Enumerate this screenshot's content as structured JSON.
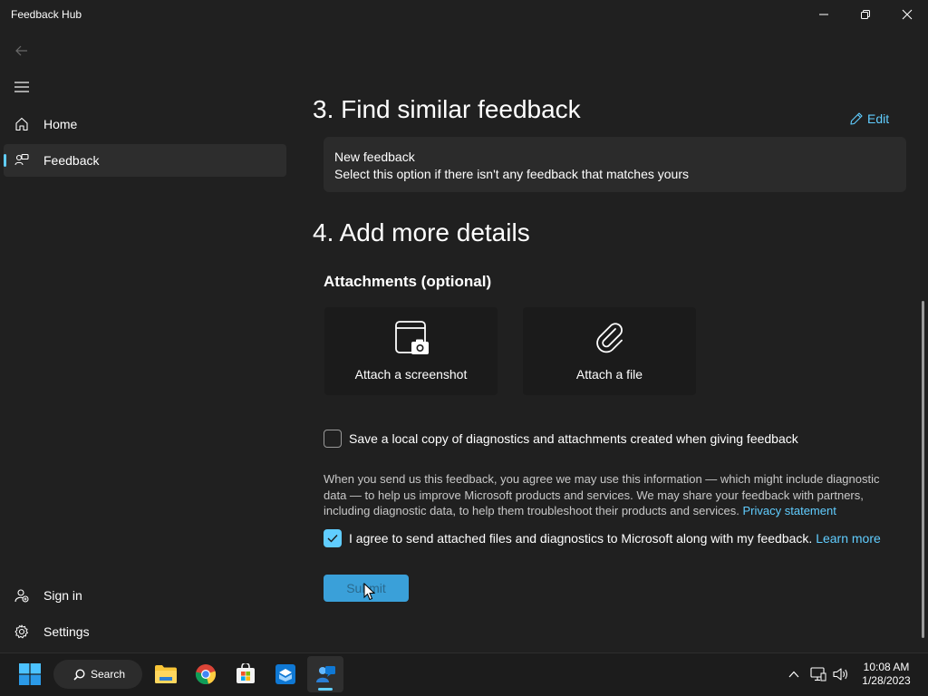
{
  "window": {
    "title": "Feedback Hub"
  },
  "nav": {
    "items": [
      {
        "label": "Home",
        "icon": "home-icon"
      },
      {
        "label": "Feedback",
        "icon": "feedback-icon",
        "selected": true
      }
    ],
    "footer": [
      {
        "label": "Sign in",
        "icon": "user-add-icon"
      },
      {
        "label": "Settings",
        "icon": "gear-icon"
      }
    ]
  },
  "main": {
    "section3": {
      "title": "3. Find similar feedback",
      "edit_label": "Edit",
      "card_title": "New feedback",
      "card_desc": "Select this option if there isn't any feedback that matches yours"
    },
    "section4": {
      "title": "4. Add more details",
      "attachments_heading": "Attachments (optional)",
      "attach_screenshot": "Attach a screenshot",
      "attach_file": "Attach a file",
      "save_copy_label": "Save a local copy of diagnostics and attachments created when giving feedback",
      "save_copy_checked": false,
      "privacy_text": "When you send us this feedback, you agree we may use this information — which might include diagnostic data — to help us improve Microsoft products and services. We may share your feedback with partners, including diagnostic data, to help them troubleshoot their products and services.",
      "privacy_link": "Privacy statement",
      "agree_label": "I agree to send attached files and diagnostics to Microsoft along with my feedback.",
      "agree_checked": true,
      "learn_more": "Learn more",
      "submit_label": "Submit"
    }
  },
  "taskbar": {
    "search_label": "Search",
    "time": "10:08 AM",
    "date": "1/28/2023",
    "apps": [
      "start-icon",
      "file-explorer-icon",
      "chrome-icon",
      "store-icon",
      "mail-icon",
      "feedback-hub-icon"
    ]
  },
  "colors": {
    "accent": "#60cdff",
    "background": "#202020",
    "card": "#2b2b2b",
    "submit": "#3aa0d9"
  }
}
